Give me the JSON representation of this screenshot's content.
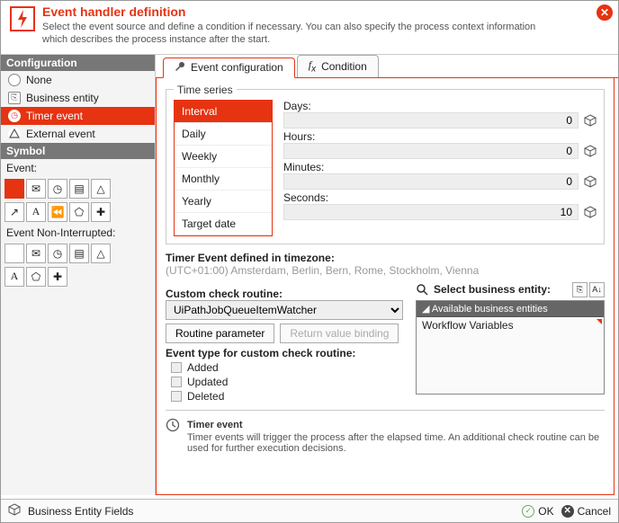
{
  "header": {
    "title": "Event handler definition",
    "subtitle": "Select the event source and define a condition if necessary. You can also specify the process context information which describes the process instance after the start."
  },
  "sidebar": {
    "configuration_label": "Configuration",
    "items": [
      {
        "label": "None"
      },
      {
        "label": "Business entity"
      },
      {
        "label": "Timer event"
      },
      {
        "label": "External event"
      }
    ],
    "selected_index": 2,
    "symbol_label": "Symbol",
    "event_label": "Event:",
    "event_noninterrupted_label": "Event Non-Interrupted:"
  },
  "tabs": [
    {
      "label": "Event configuration"
    },
    {
      "label": "Condition"
    }
  ],
  "active_tab": 0,
  "timeseries": {
    "legend": "Time series",
    "periods": [
      "Interval",
      "Daily",
      "Weekly",
      "Monthly",
      "Yearly",
      "Target date"
    ],
    "selected_period": 0,
    "fields": {
      "days": {
        "label": "Days:",
        "value": "0"
      },
      "hours": {
        "label": "Hours:",
        "value": "0"
      },
      "minutes": {
        "label": "Minutes:",
        "value": "0"
      },
      "seconds": {
        "label": "Seconds:",
        "value": "10"
      }
    }
  },
  "timezone": {
    "label": "Timer Event defined in timezone:",
    "value": "(UTC+01:00) Amsterdam, Berlin, Bern, Rome, Stockholm, Vienna"
  },
  "custom_routine": {
    "label": "Custom check routine:",
    "selected": "UiPathJobQueueItemWatcher",
    "routine_parameter_btn": "Routine parameter",
    "return_value_btn": "Return value binding",
    "event_type_label": "Event type for custom check routine:",
    "checks": {
      "added": "Added",
      "updated": "Updated",
      "deleted": "Deleted"
    }
  },
  "business_entity": {
    "label": "Select business entity:",
    "group": "Available business entities",
    "items": [
      "Workflow Variables"
    ]
  },
  "timer_foot": {
    "title": "Timer event",
    "desc": "Timer events will trigger the process after the elapsed time. An additional check routine can be used for further execution decisions."
  },
  "footer": {
    "left": "Business Entity Fields",
    "ok": "OK",
    "cancel": "Cancel"
  }
}
